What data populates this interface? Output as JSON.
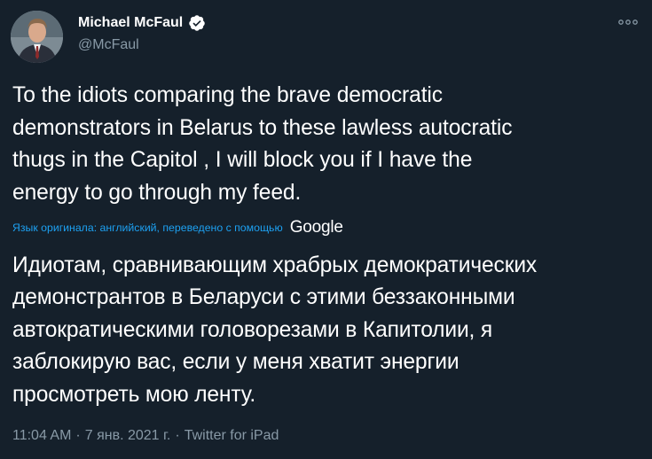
{
  "author": {
    "display_name": "Michael McFaul",
    "handle": "@McFaul",
    "verified": true
  },
  "tweet": {
    "text": "To the idiots comparing the brave democratic\ndemonstrators in Belarus to these lawless autocratic\nthugs in the Capitol , I will block you if I have the\nenergy to go through my feed.",
    "translation_note": "Язык оригинала: английский, переведено с помощью",
    "translation_provider": "Google",
    "translated_text": "Идиотам, сравнивающим храбрых демократических\nдемонстрантов в Беларуси с этими беззаконными\nавтократическими головорезами в Капитолии, я\nзаблокирую вас, если у меня хватит энергии\nпросмотреть мою ленту."
  },
  "meta": {
    "time": "11:04 AM",
    "separator": "·",
    "date": "7 янв. 2021 г.",
    "source": "Twitter for iPad"
  },
  "icons": {
    "verified": "verified-badge-icon",
    "more": "more-options-icon"
  },
  "colors": {
    "background": "#15202b",
    "text_primary": "#ffffff",
    "text_secondary": "#8899a6",
    "accent": "#1da1f2"
  }
}
